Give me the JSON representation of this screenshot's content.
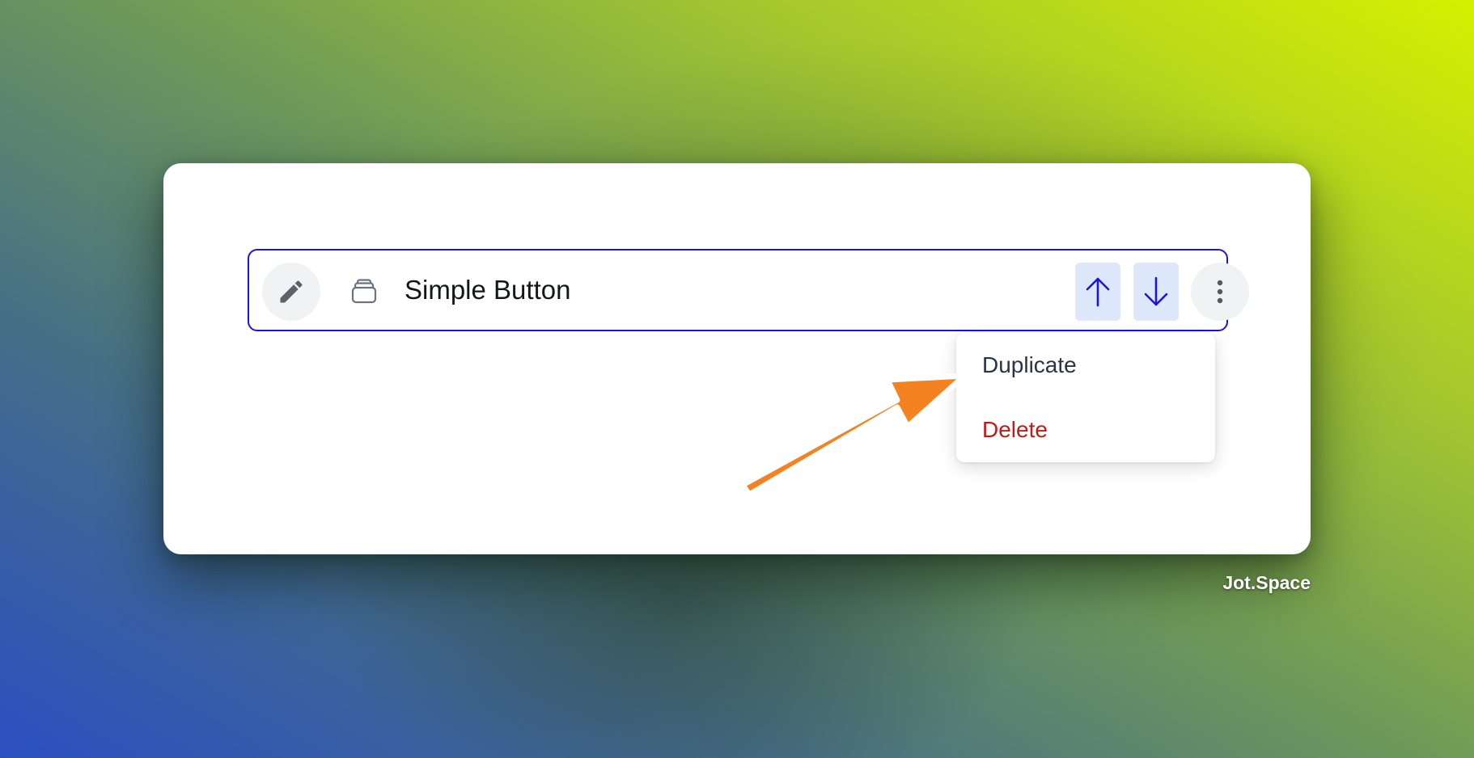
{
  "row": {
    "title": "Simple Button",
    "edit_icon": "pencil-icon",
    "type_icon": "stack-icon",
    "move_up_icon": "arrow-up-icon",
    "move_down_icon": "arrow-down-icon",
    "more_icon": "dots-vertical-icon"
  },
  "menu": {
    "items": [
      {
        "label": "Duplicate"
      },
      {
        "label": "Delete"
      }
    ]
  },
  "annotation": {
    "icon": "callout-arrow-icon",
    "color": "#f58220"
  },
  "colors": {
    "accent": "#1a14e0",
    "move_button_bg": "#dde9fb",
    "danger": "#c01b17"
  },
  "brand": "Jot.Space"
}
